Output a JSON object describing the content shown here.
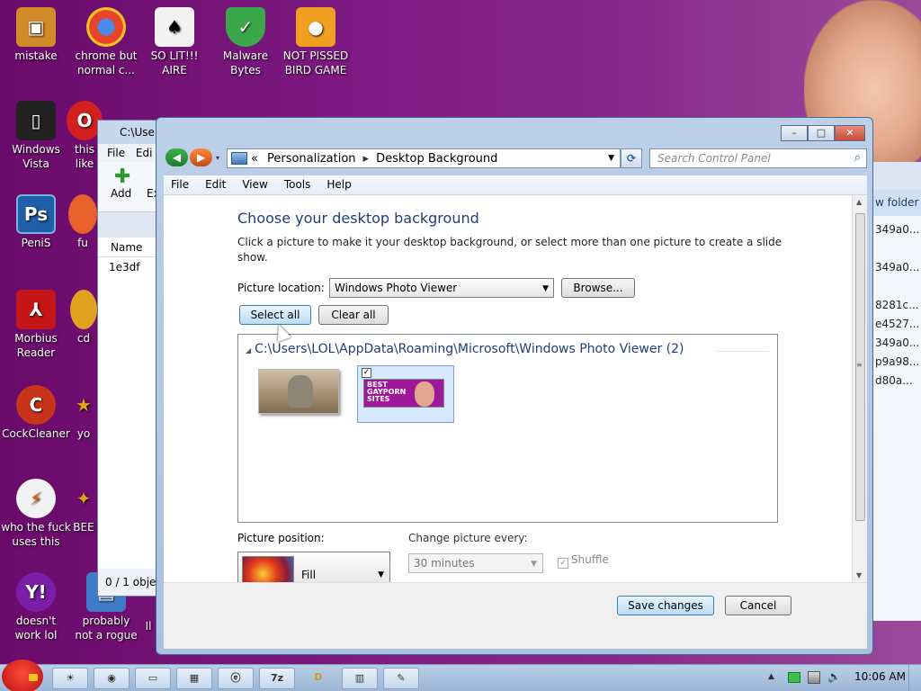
{
  "desktop": {
    "icons": [
      {
        "label": "mistake",
        "icon": "computer-icon",
        "color": "#d08a2a"
      },
      {
        "label": "chrome but\nnormal c...",
        "icon": "chrome-icon",
        "color": "#e8442c"
      },
      {
        "label": "SO LIT!!!\nAIRE",
        "icon": "solitaire-icon",
        "color": "#f2f2f2"
      },
      {
        "label": "Malware\nBytes",
        "icon": "shield-check-icon",
        "color": "#3aa84a"
      },
      {
        "label": "NOT PISSED\nBIRD GAME",
        "icon": "bad-piggies-icon",
        "color": "#f0a020"
      },
      {
        "label": "Windows\nVista",
        "icon": "recycle-bin-icon",
        "color": "#222222"
      },
      {
        "label": "this\nlike",
        "icon": "opera-icon",
        "color": "#d21f1f"
      },
      {
        "label": "PeniS",
        "icon": "photoshop-icon",
        "color": "#1f5fa8"
      },
      {
        "label": "fu",
        "icon": "firefox-icon",
        "color": "#e8602c"
      },
      {
        "label": "Morbius\nReader",
        "icon": "pdf-reader-icon",
        "color": "#c41616"
      },
      {
        "label": "cd",
        "icon": "cd-icon",
        "color": "#e0a020"
      },
      {
        "label": "CockCleaner",
        "icon": "ccleaner-icon",
        "color": "#c8341a"
      },
      {
        "label": "yo",
        "icon": "star-icon",
        "color": "#e0a020"
      },
      {
        "label": "who the fuck\nuses this",
        "icon": "winamp-icon",
        "color": "#e06010"
      },
      {
        "label": "BEE",
        "icon": "bee-icon",
        "color": "#e0a020"
      },
      {
        "label": "doesn't\nwork lol",
        "icon": "yahoo-messenger-icon",
        "color": "#7a1fa8"
      },
      {
        "label": "probably\nnot a rogue",
        "icon": "program-icon",
        "color": "#3f7ac8"
      },
      {
        "label": "Il",
        "icon": "generic-icon",
        "color": "#888888"
      }
    ]
  },
  "bg_explorer": {
    "title": "C:\\Use",
    "menu": [
      "File",
      "Edi"
    ],
    "toolbar_add": "Add",
    "toolbar_extract": "Ex",
    "column_name": "Name",
    "file": "1e3df",
    "status": "0 / 1 obje"
  },
  "bg_right_window": {
    "new_folder": "w folder",
    "items": [
      "349a0...",
      "",
      "349a0...",
      "",
      "8281c...",
      "e4527...",
      "349a0...",
      "p9a98...",
      "d80a..."
    ]
  },
  "window": {
    "nav": {
      "breadcrumb": [
        "Personalization",
        "Desktop Background"
      ],
      "breadcrumb_prefix": "«",
      "search_placeholder": "Search Control Panel"
    },
    "menu": [
      "File",
      "Edit",
      "View",
      "Tools",
      "Help"
    ],
    "title": "Choose your desktop background",
    "description": "Click a picture to make it your desktop background, or select more than one picture to create a slide show.",
    "picture_location_label": "Picture location:",
    "picture_location_value": "Windows Photo Viewer",
    "browse_label": "Browse...",
    "select_all_label": "Select all",
    "clear_all_label": "Clear all",
    "group_header": "C:\\Users\\LOL\\AppData\\Roaming\\Microsoft\\Windows Photo Viewer (2)",
    "thumbnails": [
      {
        "name": "kitten-thumbnail",
        "selected": false
      },
      {
        "name": "gay-porn-sites-thumbnail",
        "selected": true,
        "caption": "BEST\nGAYPORN\nSITES"
      }
    ],
    "picture_position_label": "Picture position:",
    "picture_position_value": "Fill",
    "change_picture_label": "Change picture every:",
    "change_picture_value": "30 minutes",
    "shuffle_label": "Shuffle",
    "save_label": "Save changes",
    "cancel_label": "Cancel"
  },
  "taskbar": {
    "clock": "10:06 AM",
    "buttons": [
      "explorer-icon",
      "chrome-icon",
      "cmd-icon",
      "file-manager-icon",
      "ie-icon",
      "7zip-icon",
      "game-icon",
      "archive-icon",
      "tool-icon"
    ]
  }
}
